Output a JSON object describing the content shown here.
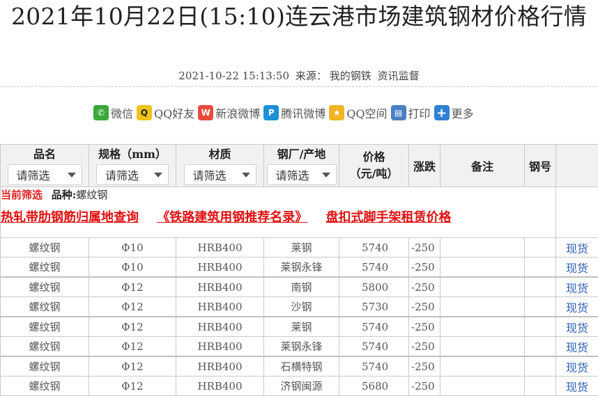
{
  "title": "2021年10月22日(15:10)连云港市场建筑钢材价格行情",
  "meta": {
    "datetime": "2021-10-22 15:13:50",
    "source_label": "来源：",
    "source": "我的钢铁",
    "column": "资讯监督"
  },
  "share": [
    {
      "label": "微信",
      "icon": "wechat-icon",
      "glyph": "✆"
    },
    {
      "label": "QQ好友",
      "icon": "qq-icon",
      "glyph": "Q"
    },
    {
      "label": "新浪微博",
      "icon": "weibo-icon",
      "glyph": "W"
    },
    {
      "label": "腾讯微博",
      "icon": "tencent-weibo-icon",
      "glyph": "P"
    },
    {
      "label": "QQ空间",
      "icon": "qzone-icon",
      "glyph": "★"
    },
    {
      "label": "打印",
      "icon": "print-icon",
      "glyph": "▤"
    },
    {
      "label": "更多",
      "icon": "more-icon",
      "glyph": "+"
    }
  ],
  "table": {
    "headers": {
      "name": "品名",
      "spec": "规格（mm）",
      "material": "材质",
      "mill": "钢厂/产地",
      "price_line1": "价格",
      "price_line2": "（元/吨）",
      "change": "涨跌",
      "remark": "备注",
      "grade": "钢号"
    },
    "filter_placeholder": "请筛选",
    "current_filter": {
      "label": "当前筛选",
      "key": "品种:",
      "value": "螺纹钢"
    },
    "promos": [
      "热轧带肋钢筋归属地查询",
      "《铁路建筑用钢推荐名录》",
      "盘扣式脚手架租赁价格"
    ],
    "rows": [
      {
        "name": "螺纹钢",
        "spec": "Φ10",
        "material": "HRB400",
        "mill": "莱钢",
        "price": "5740",
        "change": "-250",
        "remark": "",
        "grade": "",
        "action": "现货"
      },
      {
        "name": "螺纹钢",
        "spec": "Φ10",
        "material": "HRB400",
        "mill": "莱钢永锋",
        "price": "5740",
        "change": "-250",
        "remark": "",
        "grade": "",
        "action": "现货"
      },
      {
        "name": "螺纹钢",
        "spec": "Φ12",
        "material": "HRB400",
        "mill": "南钢",
        "price": "5800",
        "change": "-250",
        "remark": "",
        "grade": "",
        "action": "现货"
      },
      {
        "name": "螺纹钢",
        "spec": "Φ12",
        "material": "HRB400",
        "mill": "沙钢",
        "price": "5730",
        "change": "-250",
        "remark": "",
        "grade": "",
        "action": "现货"
      },
      {
        "name": "螺纹钢",
        "spec": "Φ12",
        "material": "HRB400",
        "mill": "莱钢",
        "price": "5740",
        "change": "-250",
        "remark": "",
        "grade": "",
        "action": "现货"
      },
      {
        "name": "螺纹钢",
        "spec": "Φ12",
        "material": "HRB400",
        "mill": "莱钢永锋",
        "price": "5740",
        "change": "-250",
        "remark": "",
        "grade": "",
        "action": "现货"
      },
      {
        "name": "螺纹钢",
        "spec": "Φ12",
        "material": "HRB400",
        "mill": "石横特钢",
        "price": "5740",
        "change": "-250",
        "remark": "",
        "grade": "",
        "action": "现货"
      },
      {
        "name": "螺纹钢",
        "spec": "Φ12",
        "material": "HRB400",
        "mill": "济钢闽源",
        "price": "5680",
        "change": "-250",
        "remark": "",
        "grade": "",
        "action": "现货"
      }
    ]
  },
  "colors": {
    "accent_red": "#e01010",
    "link_blue": "#2a5fb5",
    "header_bg": "#f1f1f1"
  }
}
